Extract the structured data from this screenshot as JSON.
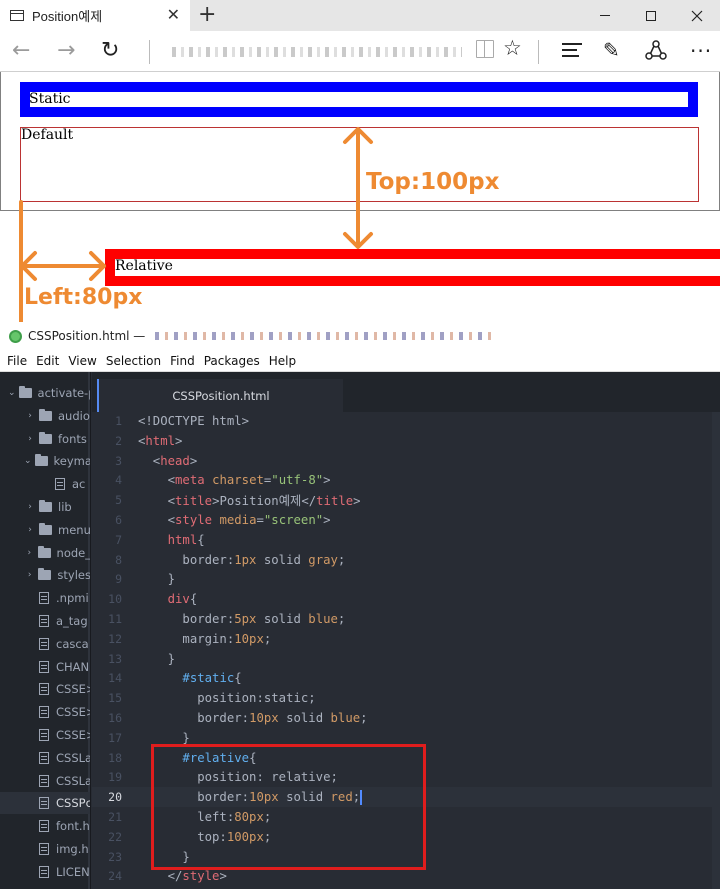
{
  "browser": {
    "tab_title": "Position예제",
    "tab_close": "✕",
    "new_tab": "+",
    "back": "←",
    "forward": "→",
    "refresh": "↻",
    "favorite": "☆",
    "notes": "✎",
    "more": "···"
  },
  "page": {
    "static_label": "Static",
    "default_label": "Default",
    "relative_label": "Relative",
    "annotation_top": "Top:100px",
    "annotation_left": "Left:80px",
    "annotation_color": "#ee8a32"
  },
  "editor": {
    "window_title": "CSSPosition.html —",
    "menu": [
      "File",
      "Edit",
      "View",
      "Selection",
      "Find",
      "Packages",
      "Help"
    ],
    "active_tab": "CSSPosition.html",
    "tree": [
      {
        "label": "activate-p",
        "type": "folder",
        "chevron": "⌄",
        "indent": 0
      },
      {
        "label": "audio",
        "type": "folder",
        "chevron": "›",
        "indent": 1
      },
      {
        "label": "fonts",
        "type": "folder",
        "chevron": "›",
        "indent": 1
      },
      {
        "label": "keyma",
        "type": "folder",
        "chevron": "⌄",
        "indent": 1
      },
      {
        "label": "ac",
        "type": "file",
        "chevron": "",
        "indent": 2
      },
      {
        "label": "lib",
        "type": "folder",
        "chevron": "›",
        "indent": 1
      },
      {
        "label": "menu",
        "type": "folder",
        "chevron": "›",
        "indent": 1
      },
      {
        "label": "node_",
        "type": "folder",
        "chevron": "›",
        "indent": 1
      },
      {
        "label": "styles",
        "type": "folder",
        "chevron": "›",
        "indent": 1
      },
      {
        "label": ".npmi",
        "type": "file",
        "chevron": "",
        "indent": 1
      },
      {
        "label": "a_tag",
        "type": "file",
        "chevron": "",
        "indent": 1
      },
      {
        "label": "casca",
        "type": "file",
        "chevron": "",
        "indent": 1
      },
      {
        "label": "CHAN",
        "type": "file",
        "chevron": "",
        "indent": 1
      },
      {
        "label": "CSSE>",
        "type": "file",
        "chevron": "",
        "indent": 1
      },
      {
        "label": "CSSE>",
        "type": "file",
        "chevron": "",
        "indent": 1
      },
      {
        "label": "CSSE>",
        "type": "file",
        "chevron": "",
        "indent": 1
      },
      {
        "label": "CSSLa",
        "type": "file",
        "chevron": "",
        "indent": 1
      },
      {
        "label": "CSSLa",
        "type": "file",
        "chevron": "",
        "indent": 1
      },
      {
        "label": "CSSPc",
        "type": "file",
        "chevron": "",
        "indent": 1,
        "selected": true
      },
      {
        "label": "font.h",
        "type": "file",
        "chevron": "",
        "indent": 1
      },
      {
        "label": "img.h",
        "type": "file",
        "chevron": "",
        "indent": 1
      },
      {
        "label": "LICEN",
        "type": "file",
        "chevron": "",
        "indent": 1
      }
    ],
    "lines": [
      {
        "n": "1",
        "tokens": [
          [
            "p",
            "<!DOCTYPE html>"
          ]
        ]
      },
      {
        "n": "2",
        "tokens": [
          [
            "p",
            "<"
          ],
          [
            "t",
            "html"
          ],
          [
            "p",
            ">"
          ]
        ]
      },
      {
        "n": "3",
        "tokens": [
          [
            "p",
            "  <"
          ],
          [
            "t",
            "head"
          ],
          [
            "p",
            ">"
          ]
        ]
      },
      {
        "n": "4",
        "tokens": [
          [
            "p",
            "    <"
          ],
          [
            "t",
            "meta"
          ],
          [
            "p",
            " "
          ],
          [
            "a",
            "charset"
          ],
          [
            "p",
            "="
          ],
          [
            "s",
            "\"utf-8\""
          ],
          [
            "p",
            ">"
          ]
        ]
      },
      {
        "n": "5",
        "tokens": [
          [
            "p",
            "    <"
          ],
          [
            "t",
            "title"
          ],
          [
            "p",
            ">Position예제</"
          ],
          [
            "t",
            "title"
          ],
          [
            "p",
            ">"
          ]
        ]
      },
      {
        "n": "6",
        "tokens": [
          [
            "p",
            "    <"
          ],
          [
            "t",
            "style"
          ],
          [
            "p",
            " "
          ],
          [
            "a",
            "media"
          ],
          [
            "p",
            "="
          ],
          [
            "s",
            "\"screen\""
          ],
          [
            "p",
            ">"
          ]
        ]
      },
      {
        "n": "7",
        "tokens": [
          [
            "p",
            "    "
          ],
          [
            "k",
            "html"
          ],
          [
            "p",
            "{"
          ]
        ]
      },
      {
        "n": "8",
        "tokens": [
          [
            "p",
            "      border:"
          ],
          [
            "n",
            "1px"
          ],
          [
            "p",
            " solid "
          ],
          [
            "a",
            "gray"
          ],
          [
            "p",
            ";"
          ]
        ]
      },
      {
        "n": "9",
        "tokens": [
          [
            "p",
            "    }"
          ]
        ]
      },
      {
        "n": "10",
        "tokens": [
          [
            "p",
            "    "
          ],
          [
            "k",
            "div"
          ],
          [
            "p",
            "{"
          ]
        ]
      },
      {
        "n": "11",
        "tokens": [
          [
            "p",
            "      border:"
          ],
          [
            "n",
            "5px"
          ],
          [
            "p",
            " solid "
          ],
          [
            "a",
            "blue"
          ],
          [
            "p",
            ";"
          ]
        ]
      },
      {
        "n": "12",
        "tokens": [
          [
            "p",
            "      margin:"
          ],
          [
            "n",
            "10px"
          ],
          [
            "p",
            ";"
          ]
        ]
      },
      {
        "n": "13",
        "tokens": [
          [
            "p",
            "    }"
          ]
        ]
      },
      {
        "n": "14",
        "tokens": [
          [
            "p",
            "      "
          ],
          [
            "id",
            "#static"
          ],
          [
            "p",
            "{"
          ]
        ]
      },
      {
        "n": "15",
        "tokens": [
          [
            "p",
            "        position:static;"
          ]
        ]
      },
      {
        "n": "16",
        "tokens": [
          [
            "p",
            "        border:"
          ],
          [
            "n",
            "10px"
          ],
          [
            "p",
            " solid "
          ],
          [
            "a",
            "blue"
          ],
          [
            "p",
            ";"
          ]
        ]
      },
      {
        "n": "17",
        "tokens": [
          [
            "p",
            "      }"
          ]
        ]
      },
      {
        "n": "18",
        "tokens": [
          [
            "p",
            "      "
          ],
          [
            "id",
            "#relative"
          ],
          [
            "p",
            "{"
          ]
        ]
      },
      {
        "n": "19",
        "tokens": [
          [
            "p",
            "        position: relative;"
          ]
        ]
      },
      {
        "n": "20",
        "tokens": [
          [
            "p",
            "        border:"
          ],
          [
            "n",
            "10px"
          ],
          [
            "p",
            " solid "
          ],
          [
            "a",
            "red"
          ],
          [
            "p",
            ";"
          ]
        ],
        "current": true
      },
      {
        "n": "21",
        "tokens": [
          [
            "p",
            "        left:"
          ],
          [
            "n",
            "80px"
          ],
          [
            "p",
            ";"
          ]
        ]
      },
      {
        "n": "22",
        "tokens": [
          [
            "p",
            "        top:"
          ],
          [
            "n",
            "100px"
          ],
          [
            "p",
            ";"
          ]
        ]
      },
      {
        "n": "23",
        "tokens": [
          [
            "p",
            "      }"
          ]
        ]
      },
      {
        "n": "24",
        "tokens": [
          [
            "p",
            "    </"
          ],
          [
            "t",
            "style"
          ],
          [
            "p",
            ">"
          ]
        ]
      }
    ]
  }
}
